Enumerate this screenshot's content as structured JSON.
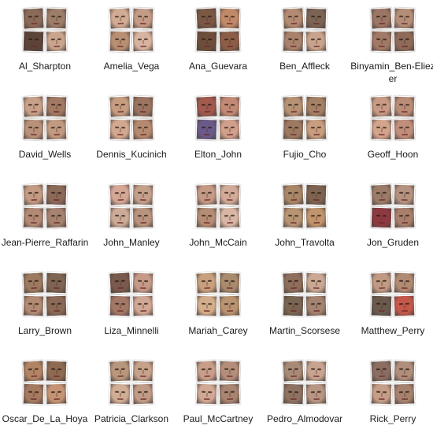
{
  "folders": [
    {
      "label": "Al_Sharpton",
      "icon": "face-thumbnails-icon",
      "tiles": [
        "#8a6a58",
        "#9c7e6a",
        "#5c4438",
        "#c9a58e"
      ]
    },
    {
      "label": "Amelia_Vega",
      "icon": "face-thumbnails-icon",
      "tiles": [
        "#d2ab94",
        "#c49b86",
        "#b98f74",
        "#d8b4a0"
      ]
    },
    {
      "label": "Ana_Guevara",
      "icon": "face-thumbnails-icon",
      "tiles": [
        "#7a5844",
        "#c08a6a",
        "#6e4e3a",
        "#8c5e48"
      ]
    },
    {
      "label": "Ben_Affleck",
      "icon": "face-thumbnails-icon",
      "tiles": [
        "#b38b72",
        "#7c6454",
        "#a8826c",
        "#c8a48e"
      ]
    },
    {
      "label": "Binyamin_Ben-Eliezer",
      "icon": "face-thumbnails-icon",
      "tiles": [
        "#9b7664",
        "#b48e78",
        "#a07a66",
        "#8e6a58"
      ]
    },
    {
      "label": "David_Wells",
      "icon": "face-thumbnails-icon",
      "tiles": [
        "#c7a089",
        "#a27a64",
        "#b7917a",
        "#c29a82"
      ]
    },
    {
      "label": "Dennis_Kucinich",
      "icon": "face-thumbnails-icon",
      "tiles": [
        "#c79d82",
        "#9a7460",
        "#d3a890",
        "#b68a70"
      ]
    },
    {
      "label": "Elton_John",
      "icon": "face-thumbnails-icon",
      "tiles": [
        "#a25a4e",
        "#c28a76",
        "#6a5a8a",
        "#d0a08c"
      ]
    },
    {
      "label": "Fujio_Cho",
      "icon": "face-thumbnails-icon",
      "tiles": [
        "#b69274",
        "#a48064",
        "#9c7a62",
        "#c79e80"
      ]
    },
    {
      "label": "Geoff_Hoon",
      "icon": "face-thumbnails-icon",
      "tiles": [
        "#c69a84",
        "#b88c76",
        "#d2a48c",
        "#c08e7a"
      ]
    },
    {
      "label": "Jean-Pierre_Raffarin",
      "icon": "face-thumbnails-icon",
      "tiles": [
        "#c39a84",
        "#8c6a58",
        "#b28a74",
        "#a68270"
      ]
    },
    {
      "label": "John_Manley",
      "icon": "face-thumbnails-icon",
      "tiles": [
        "#d5a896",
        "#c4a08c",
        "#ccab98",
        "#b8947e"
      ]
    },
    {
      "label": "John_McCain",
      "icon": "face-thumbnails-icon",
      "tiles": [
        "#c49a84",
        "#d1ab98",
        "#b58c74",
        "#d8b6a4"
      ]
    },
    {
      "label": "John_Travolta",
      "icon": "face-thumbnails-icon",
      "tiles": [
        "#a88668",
        "#7e6450",
        "#b69474",
        "#c0946c"
      ]
    },
    {
      "label": "Jon_Gruden",
      "icon": "face-thumbnails-icon",
      "tiles": [
        "#9a7c68",
        "#b59280",
        "#8c3a40",
        "#a87e6c"
      ]
    },
    {
      "label": "Larry_Brown",
      "icon": "face-thumbnails-icon",
      "tiles": [
        "#9c7a62",
        "#7e6452",
        "#b08a72",
        "#8a6a56"
      ]
    },
    {
      "label": "Liza_Minnelli",
      "icon": "face-thumbnails-icon",
      "tiles": [
        "#7a5a4c",
        "#c59a88",
        "#a47866",
        "#d0a694"
      ]
    },
    {
      "label": "Mariah_Carey",
      "icon": "face-thumbnails-icon",
      "tiles": [
        "#c8a07e",
        "#a88a6c",
        "#d4ae8c",
        "#b89470"
      ]
    },
    {
      "label": "Martin_Scorsese",
      "icon": "face-thumbnails-icon",
      "tiles": [
        "#8e6e5c",
        "#c9a894",
        "#7a6452",
        "#a28470"
      ]
    },
    {
      "label": "Matthew_Perry",
      "icon": "face-thumbnails-icon",
      "tiles": [
        "#c09a84",
        "#b08a72",
        "#6a5a4e",
        "#c4584a"
      ]
    },
    {
      "label": "Oscar_De_La_Hoya",
      "icon": "face-thumbnails-icon",
      "tiles": [
        "#b08464",
        "#8e6a52",
        "#a47a60",
        "#c49474"
      ]
    },
    {
      "label": "Patricia_Clarkson",
      "icon": "face-thumbnails-icon",
      "tiles": [
        "#b9977c",
        "#c6a28a",
        "#d0ae96",
        "#c09c86"
      ]
    },
    {
      "label": "Paul_McCartney",
      "icon": "face-thumbnails-icon",
      "tiles": [
        "#c89e88",
        "#b48e7a",
        "#d0a894",
        "#a88472"
      ]
    },
    {
      "label": "Pedro_Almodovar",
      "icon": "face-thumbnails-icon",
      "tiles": [
        "#a88a76",
        "#c6a490",
        "#8e7262",
        "#b89684"
      ]
    },
    {
      "label": "Rick_Perry",
      "icon": "face-thumbnails-icon",
      "tiles": [
        "#8a6e62",
        "#b08e7c",
        "#c59e88",
        "#a6826e"
      ]
    }
  ]
}
